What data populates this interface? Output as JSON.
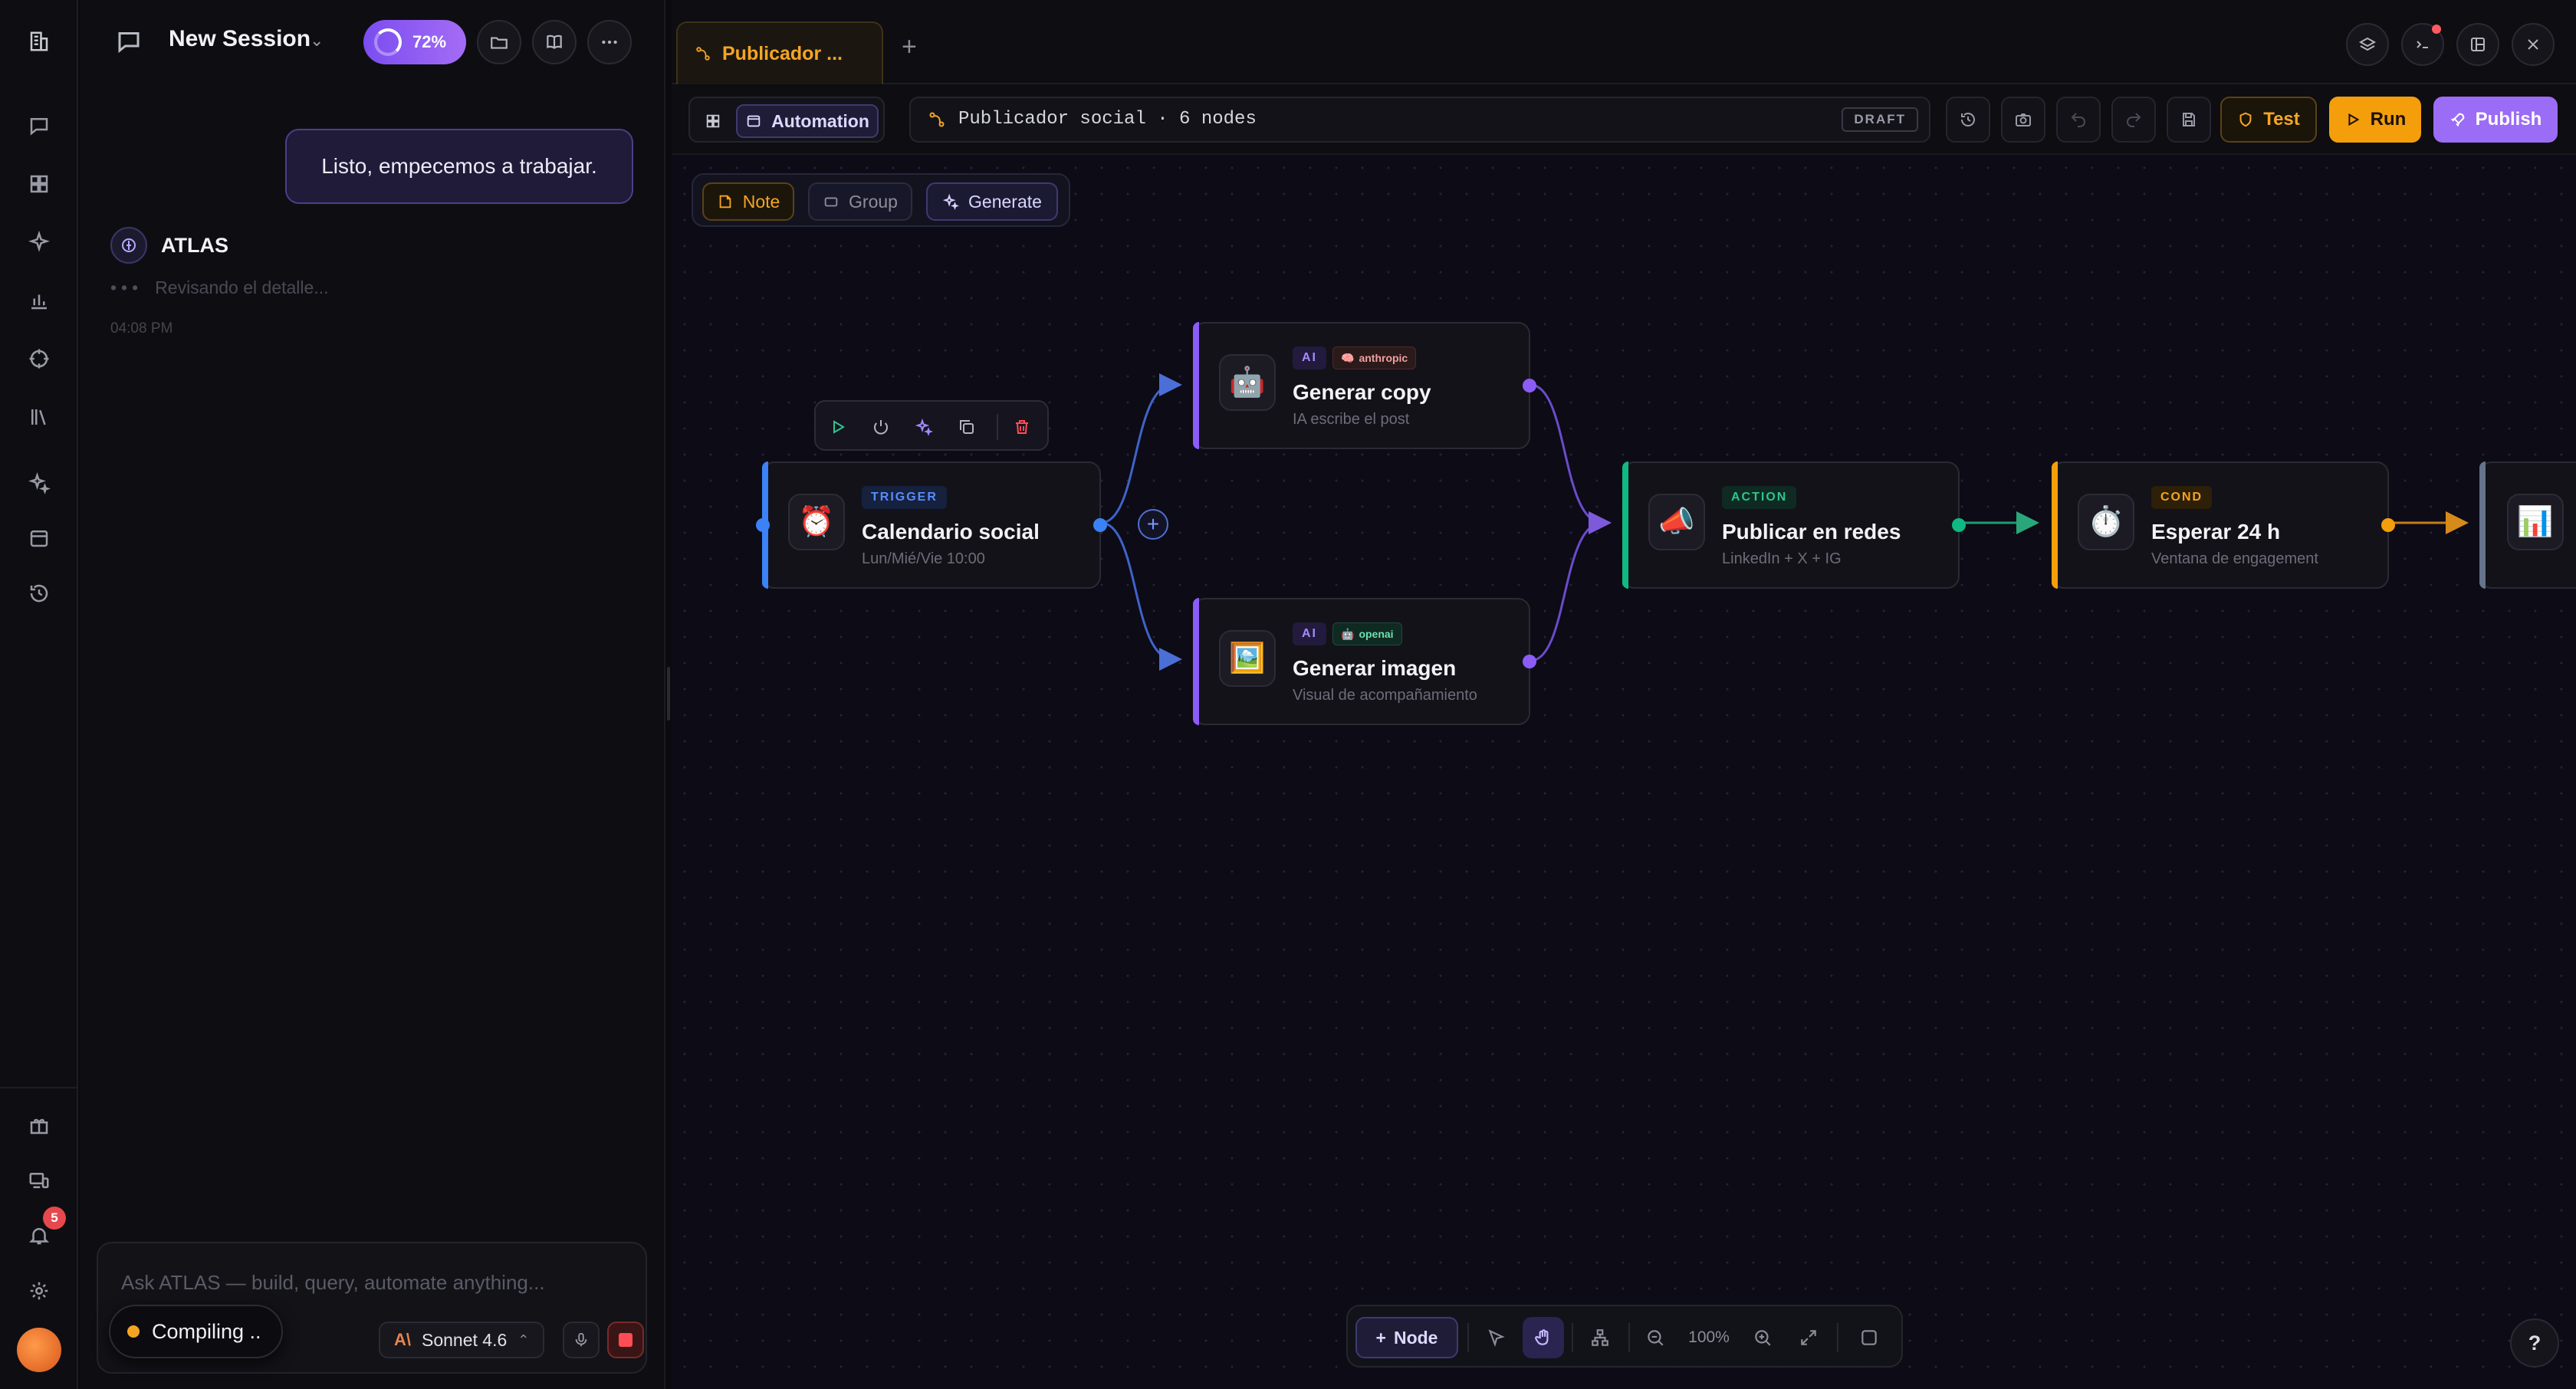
{
  "sidebar": {
    "icons": [
      "logo-icon",
      "chat-icon",
      "grid-icon",
      "sparkle-icon",
      "chart-icon",
      "target-icon",
      "library-icon",
      "magic-icon",
      "calendar-icon",
      "history-icon",
      "gift-icon",
      "devices-icon",
      "bell-icon",
      "settings-icon"
    ],
    "notifications_count": "5"
  },
  "chat": {
    "session_title": "New Session",
    "progress_pct": "72%",
    "user_message": "Listo, empecemos a trabajar.",
    "assistant_name": "ATLAS",
    "assistant_status": "Revisando el detalle...",
    "timestamp": "04:08 PM",
    "input_placeholder": "Ask ATLAS — build, query, automate anything...",
    "model_name": "Sonnet 4.6",
    "model_mark": "A\\",
    "compiling_label": "Compiling  .."
  },
  "tabs": {
    "active_label": "Publicador ...",
    "add_label": "+"
  },
  "toolbar": {
    "mode_label": "Automation",
    "flow_path": "Publicador social · 6 nodes",
    "status_badge": "DRAFT",
    "test_label": "Test",
    "run_label": "Run",
    "publish_label": "Publish"
  },
  "palette": {
    "note_label": "Note",
    "group_label": "Group",
    "generate_label": "Generate"
  },
  "nodes": {
    "trigger": {
      "tag": "TRIGGER",
      "title": "Calendario social",
      "subtitle": "Lun/Mié/Vie 10:00",
      "emoji": "⏰"
    },
    "copy": {
      "tag": "AI",
      "provider": "anthropic",
      "title": "Generar copy",
      "subtitle": "IA escribe el post",
      "emoji": "🤖"
    },
    "image": {
      "tag": "AI",
      "provider": "openai",
      "title": "Generar imagen",
      "subtitle": "Visual de acompañamiento",
      "emoji": "🖼️"
    },
    "publish": {
      "tag": "ACTION",
      "title": "Publicar en redes",
      "subtitle": "LinkedIn + X + IG",
      "emoji": "📣"
    },
    "wait": {
      "tag": "COND",
      "title": "Esperar 24 h",
      "subtitle": "Ventana de engagement",
      "emoji": "⏱️"
    },
    "report": {
      "emoji": "📊"
    }
  },
  "bottom_bar": {
    "add_node_label": "Node",
    "zoom_level": "100%"
  },
  "help_label": "?",
  "colors": {
    "trigger": "#3b82f6",
    "ai": "#8b5cf6",
    "action": "#10b981",
    "cond": "#f59e0b",
    "run": "#f59e0b",
    "publish": "#9b6cf5"
  }
}
